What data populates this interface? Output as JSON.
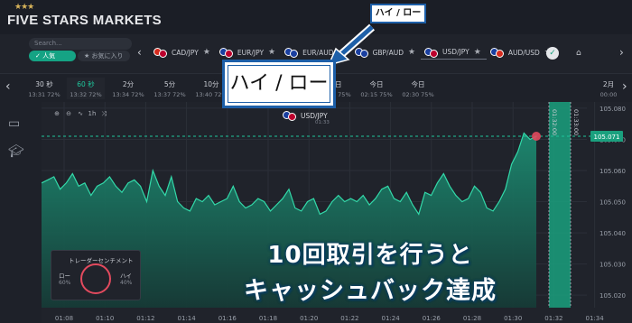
{
  "header": {
    "logo_text": "FIVE STARS MARKETS",
    "logo_stars": "★★★"
  },
  "assetbar": {
    "search_placeholder": "Search...",
    "tab_popular": "人気",
    "tab_favorites": "お気に入り",
    "assets": [
      {
        "label": "CAD/JPY",
        "c1": "#d52b1e",
        "c2": "#bc002d"
      },
      {
        "label": "EUR/JPY",
        "c1": "#1a3fa0",
        "c2": "#bc002d"
      },
      {
        "label": "EUR/AUD",
        "c1": "#1a3fa0",
        "c2": "#1a3fa0"
      },
      {
        "label": "GBP/AUD",
        "c1": "#1a3fa0",
        "c2": "#1a3fa0"
      },
      {
        "label": "USD/JPY",
        "c1": "#1a3fa0",
        "c2": "#bc002d"
      },
      {
        "label": "AUD/USD",
        "c1": "#1a3fa0",
        "c2": "#d52b1e"
      }
    ],
    "selected_asset": 4
  },
  "expiries": [
    {
      "t": "30 秒",
      "s": "13:31  72%"
    },
    {
      "t": "60 秒",
      "s": "13:32  72%"
    },
    {
      "t": "2分",
      "s": "13:34  72%"
    },
    {
      "t": "5分",
      "s": "13:37  72%"
    },
    {
      "t": "10分",
      "s": "13:40  72%"
    },
    {
      "t": "今日",
      "s": "13:30  75%"
    },
    {
      "t": "今日",
      "s": "01:45  75%"
    },
    {
      "t": "今日",
      "s": "02:00  75%"
    },
    {
      "t": "今日",
      "s": "02:15  75%"
    },
    {
      "t": "今日",
      "s": "02:30  75%"
    },
    {
      "t": "2月",
      "s": "00:00"
    }
  ],
  "chart_tools": [
    "⊕",
    "⊖",
    "∿",
    "1h",
    "⤨"
  ],
  "chart_asset": {
    "label": "USD/JPY",
    "sub": "01:33"
  },
  "chart_data": {
    "type": "area",
    "x_ticks": [
      "01:08",
      "01:10",
      "01:12",
      "01:14",
      "01:16",
      "01:18",
      "01:20",
      "01:22",
      "01:24",
      "01:26",
      "01:28",
      "01:30",
      "01:32",
      "01:34"
    ],
    "y_ticks": [
      "105.080",
      "105.070",
      "105.060",
      "105.050",
      "105.040",
      "105.030",
      "105.020"
    ],
    "ylim": [
      105.016,
      105.082
    ],
    "current_price": "105.071",
    "vline_labels": [
      "01:32:00",
      "01:33:00"
    ],
    "values": [
      105.056,
      105.057,
      105.058,
      105.054,
      105.056,
      105.059,
      105.055,
      105.056,
      105.052,
      105.055,
      105.056,
      105.058,
      105.055,
      105.053,
      105.056,
      105.057,
      105.055,
      105.05,
      105.06,
      105.055,
      105.052,
      105.058,
      105.05,
      105.048,
      105.047,
      105.051,
      105.05,
      105.052,
      105.049,
      105.05,
      105.051,
      105.055,
      105.05,
      105.048,
      105.049,
      105.051,
      105.05,
      105.047,
      105.049,
      105.051,
      105.054,
      105.048,
      105.047,
      105.05,
      105.051,
      105.046,
      105.047,
      105.05,
      105.052,
      105.05,
      105.051,
      105.05,
      105.052,
      105.049,
      105.051,
      105.054,
      105.055,
      105.051,
      105.05,
      105.053,
      105.049,
      105.046,
      105.053,
      105.052,
      105.056,
      105.059,
      105.055,
      105.052,
      105.05,
      105.051,
      105.055,
      105.053,
      105.048,
      105.047,
      105.05,
      105.054,
      105.062,
      105.066,
      105.072,
      105.07,
      105.071
    ]
  },
  "sentiment": {
    "title": "トレーダーセンチメント",
    "low_label": "ロー",
    "low_value": "60%",
    "high_label": "ハイ",
    "high_value": "40%"
  },
  "annotations": {
    "callout_small": "ハイ / ロー",
    "callout_big": "ハイ / ロー",
    "line1": "10回取引を行うと",
    "line2": "キャッシュバック達成"
  },
  "colors": {
    "accent": "#1fc59b",
    "bg": "#1e2129",
    "callout_border": "#1d5fa8"
  }
}
